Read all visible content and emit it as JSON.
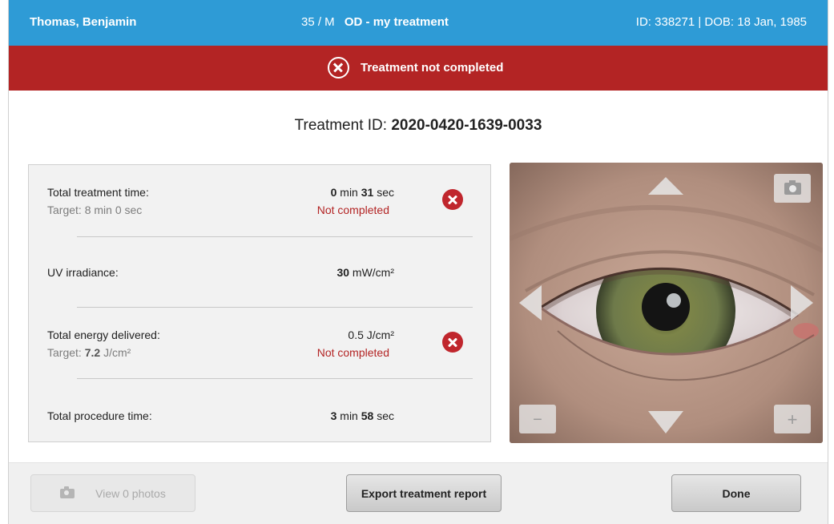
{
  "header": {
    "patient_name": "Thomas, Benjamin",
    "age_sex": "35 / M",
    "treatment_label": "OD - my treatment",
    "id_dob": "ID: 338271 | DOB: 18 Jan, 1985"
  },
  "alert": {
    "message": "Treatment not completed",
    "color": "#b32424"
  },
  "treatment": {
    "id_label": "Treatment ID:",
    "id_value": "2020-0420-1639-0033"
  },
  "stats": {
    "total_time": {
      "label": "Total treatment time:",
      "target_label": "Target: 8 min 0 sec",
      "value_min": "0",
      "unit_min": "min",
      "value_sec": "31",
      "unit_sec": "sec",
      "status": "Not completed"
    },
    "uv": {
      "label": "UV irradiance:",
      "value": "30",
      "unit": "mW/cm²"
    },
    "energy": {
      "label": "Total energy delivered:",
      "target_prefix": "Target:",
      "target_value": "7.2",
      "target_unit": "J/cm²",
      "value": "0.5",
      "unit": "J/cm²",
      "status": "Not completed"
    },
    "procedure": {
      "label": "Total procedure time:",
      "value_min": "3",
      "unit_min": "min",
      "value_sec": "58",
      "unit_sec": "sec"
    }
  },
  "viewer": {
    "zoom_out_label": "−",
    "zoom_in_label": "+"
  },
  "footer": {
    "photos_label": "View 0 photos",
    "export_label": "Export treatment report",
    "done_label": "Done"
  },
  "colors": {
    "header": "#2e9bd6",
    "error": "#c0262d"
  }
}
